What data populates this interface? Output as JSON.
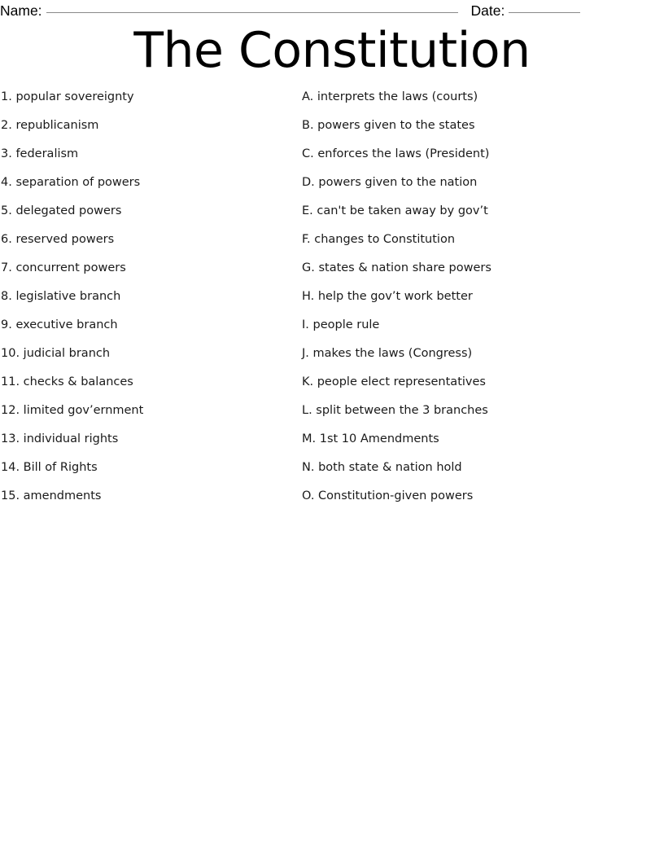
{
  "worksheet": {
    "title": "The Constitution",
    "name_label": "Name:",
    "date_label": "Date:",
    "name_rule": "_______________________________________________________",
    "date_rule": "________"
  },
  "terms": [
    {
      "number": "1.",
      "text": "popular sovereignty"
    },
    {
      "number": "2.",
      "text": "republicanism"
    },
    {
      "number": "3.",
      "text": "federalism"
    },
    {
      "number": "4.",
      "text": "separation of powers"
    },
    {
      "number": "5.",
      "text": "delegated powers"
    },
    {
      "number": "6.",
      "text": "reserved powers"
    },
    {
      "number": "7.",
      "text": "concurrent powers"
    },
    {
      "number": "8.",
      "text": "legislative branch"
    },
    {
      "number": "9.",
      "text": "executive branch"
    },
    {
      "number": "10.",
      "text": "judicial branch"
    },
    {
      "number": "11.",
      "text": "checks & balances"
    },
    {
      "number": "12.",
      "text": "limited gov’ernment"
    },
    {
      "number": "13.",
      "text": "individual rights"
    },
    {
      "number": "14.",
      "text": "Bill of Rights"
    },
    {
      "number": "15.",
      "text": "amendments"
    }
  ],
  "definitions": [
    {
      "letter": "A.",
      "text": "interprets the laws (courts)"
    },
    {
      "letter": "B.",
      "text": "powers given to the states"
    },
    {
      "letter": "C.",
      "text": "enforces the laws (President)"
    },
    {
      "letter": "D.",
      "text": "powers given to the nation"
    },
    {
      "letter": "E.",
      "text": "can't be taken away by gov’t"
    },
    {
      "letter": "F.",
      "text": "changes to Constitution"
    },
    {
      "letter": "G.",
      "text": "states & nation share powers"
    },
    {
      "letter": "H.",
      "text": "help the gov’t work better"
    },
    {
      "letter": "I.",
      "text": "people rule"
    },
    {
      "letter": "J.",
      "text": "makes the laws (Congress)"
    },
    {
      "letter": "K.",
      "text": "people elect representatives"
    },
    {
      "letter": "L.",
      "text": "split between the 3 branches"
    },
    {
      "letter": "M.",
      "text": "1st 10 Amendments"
    },
    {
      "letter": "N.",
      "text": "both state & nation hold"
    },
    {
      "letter": "O.",
      "text": "Constitution-given powers"
    }
  ],
  "terms_flat": [
    "1. popular sovereignty",
    "2. republicanism",
    "3. federalism",
    "4. separation of powers",
    "5. delegated powers",
    "6. reserved powers",
    "7. concurrent powers",
    "8. legislative branch",
    "9. executive branch",
    "10. judicial branch",
    "11. checks & balances",
    "12. limited gov’ernment",
    "13. individual rights",
    "14. Bill of Rights",
    "15. amendments"
  ],
  "definitions_flat": [
    "A. interprets the laws (courts)",
    "B. powers given to the states",
    "C. enforces the laws (President)",
    "D. powers given to the nation",
    "E. can't be taken away by gov’t",
    "F. changes to Constitution",
    "G. states & nation share powers",
    "H. help the gov’t work better",
    "I. people rule",
    "J. makes the laws (Congress)",
    "K. people elect representatives",
    "L. split between the 3 branches",
    "M. 1st 10 Amendments",
    "N. both state & nation hold",
    "O. Constitution-given powers"
  ],
  "colors": {
    "text": "#1a1a1a",
    "rule": "#8a8a8a",
    "background": "#ffffff"
  }
}
